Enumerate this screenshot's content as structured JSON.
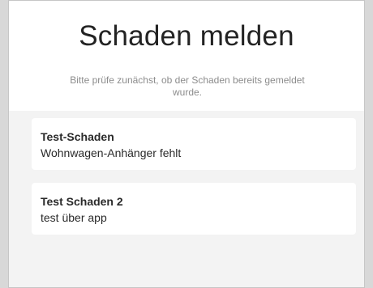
{
  "header": {
    "title": "Schaden melden",
    "subtitle": "Bitte prüfe zunächst, ob der Schaden bereits gemeldet wurde."
  },
  "damages": [
    {
      "title": "Test-Schaden",
      "description": "Wohnwagen-Anhänger fehlt"
    },
    {
      "title": "Test Schaden 2",
      "description": "test über app"
    }
  ],
  "colors": {
    "background": "#f3f3f3",
    "card": "#ffffff",
    "title_text": "#232323",
    "subtitle_text": "#8c8c8c"
  }
}
